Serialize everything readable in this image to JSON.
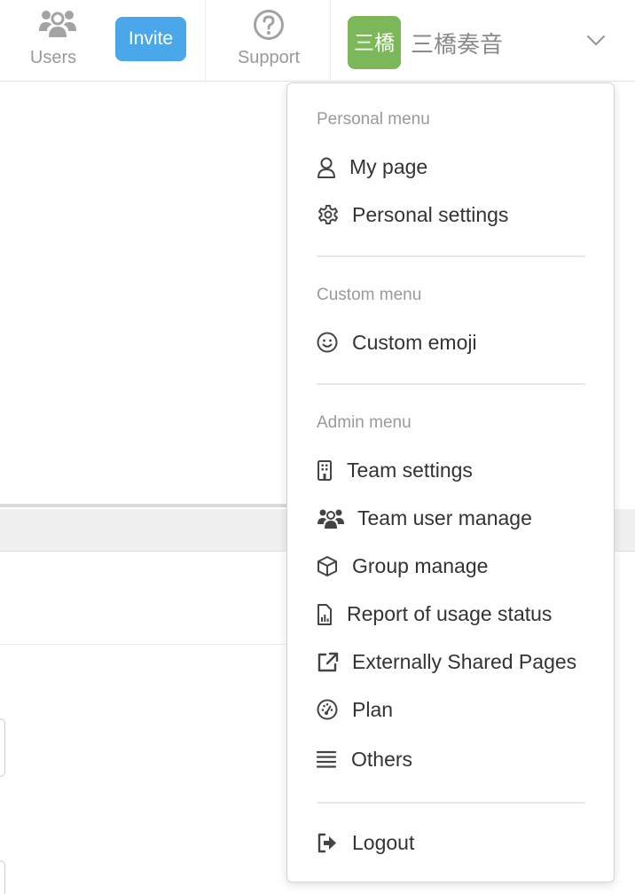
{
  "header": {
    "users_label": "Users",
    "invite_label": "Invite",
    "support_label": "Support",
    "avatar_text": "三橋",
    "user_name": "三橋奏音",
    "accent_color": "#4aa8ea",
    "avatar_color": "#7cb85a"
  },
  "menu": {
    "personal": {
      "label": "Personal menu",
      "items": [
        {
          "label": "My page",
          "icon": "user-icon"
        },
        {
          "label": "Personal settings",
          "icon": "gear-icon"
        }
      ]
    },
    "custom": {
      "label": "Custom menu",
      "items": [
        {
          "label": "Custom emoji",
          "icon": "smiley-icon"
        }
      ]
    },
    "admin": {
      "label": "Admin menu",
      "items": [
        {
          "label": "Team settings",
          "icon": "building-icon"
        },
        {
          "label": "Team user manage",
          "icon": "users-icon"
        },
        {
          "label": "Group manage",
          "icon": "cube-icon"
        },
        {
          "label": "Report of usage status",
          "icon": "report-icon"
        },
        {
          "label": "Externally Shared Pages",
          "icon": "external-link-icon"
        },
        {
          "label": "Plan",
          "icon": "gauge-icon"
        },
        {
          "label": "Others",
          "icon": "list-icon"
        }
      ]
    },
    "logout": {
      "label": "Logout",
      "icon": "logout-icon"
    }
  }
}
